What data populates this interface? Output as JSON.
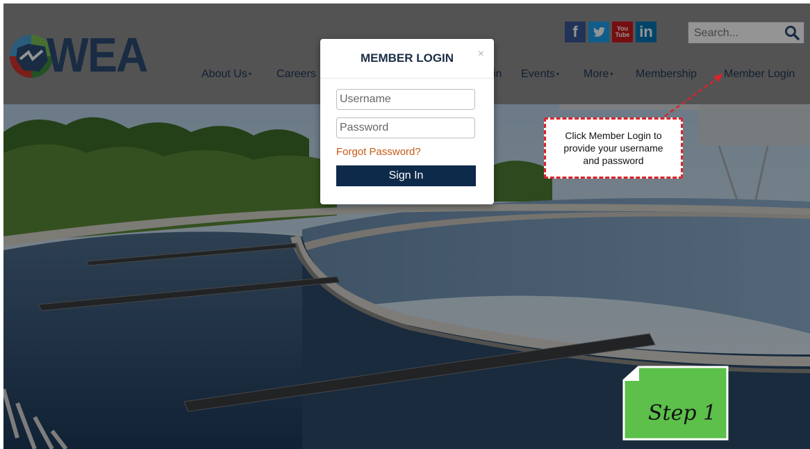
{
  "brand": {
    "logo_text": "WEA"
  },
  "header": {
    "social_icons": [
      "facebook-icon",
      "twitter-icon",
      "youtube-icon",
      "linkedin-icon"
    ],
    "youtube_label_top": "You",
    "youtube_label_bottom": "Tube",
    "facebook_glyph": "f",
    "linkedin_glyph": "in",
    "search": {
      "placeholder": "Search..."
    },
    "nav": [
      {
        "label": "About Us",
        "has_dropdown": true
      },
      {
        "label": "Careers",
        "has_dropdown": false
      },
      {
        "label": "in",
        "has_dropdown": false
      },
      {
        "label": "Events",
        "has_dropdown": true
      },
      {
        "label": "More",
        "has_dropdown": true
      },
      {
        "label": "Membership",
        "has_dropdown": false
      },
      {
        "label": "Member Login",
        "has_dropdown": false
      }
    ],
    "caret": "▾"
  },
  "modal": {
    "title": "MEMBER LOGIN",
    "close": "×",
    "username_placeholder": "Username",
    "password_placeholder": "Password",
    "forgot_label": "Forgot Password?",
    "signin_label": "Sign In"
  },
  "callout": {
    "line1": "Click Member Login to",
    "line2": "provide your username",
    "line3": "and password"
  },
  "step": {
    "label": "Step 1"
  },
  "colors": {
    "brand_navy": "#2e4d76",
    "signin_bg": "#0e2a4a",
    "forgot_link": "#c45a15",
    "callout_border": "#d9242a",
    "step_green": "#5cc04a",
    "facebook": "#3b5998",
    "twitter": "#1da1f2",
    "youtube": "#cc181e",
    "linkedin": "#0077b5"
  }
}
